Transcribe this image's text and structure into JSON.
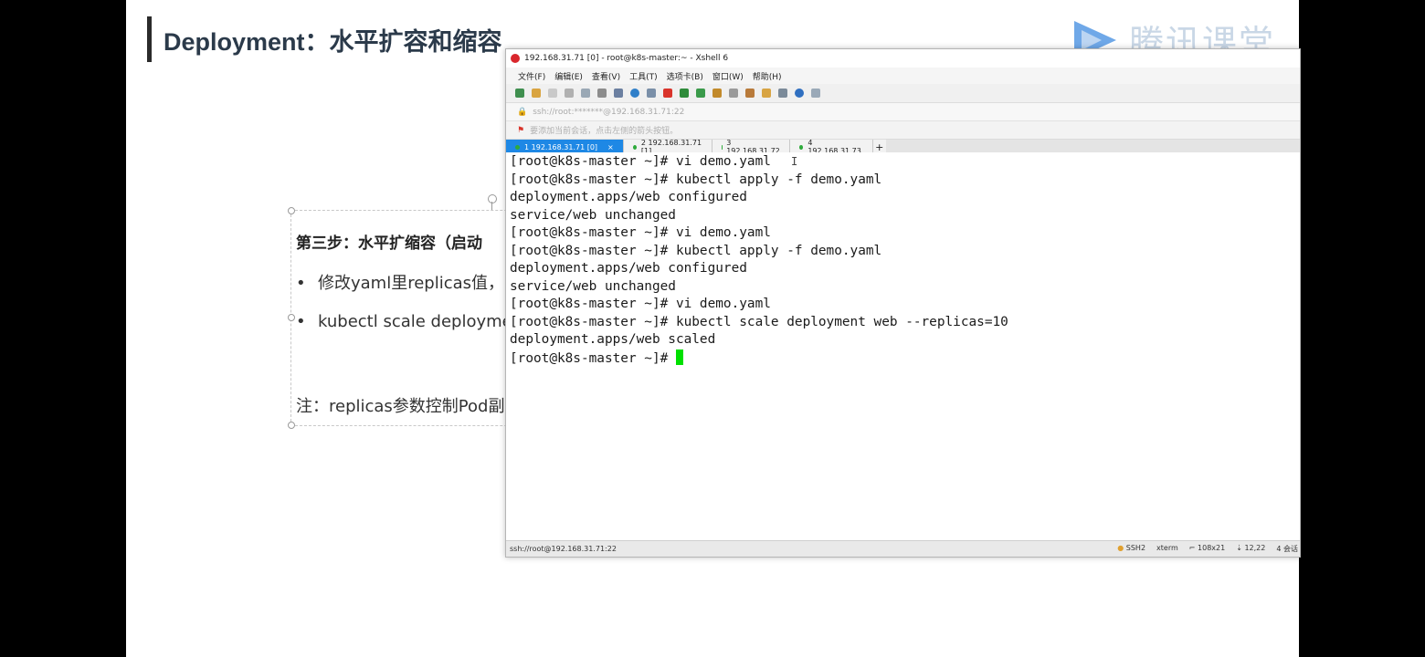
{
  "slide": {
    "title": "Deployment：水平扩容和缩容",
    "logo_text": "腾讯课堂",
    "step_title": "第三步：水平扩缩容（启动",
    "bullets": [
      "修改yaml里replicas值，",
      "kubectl scale deployme"
    ],
    "note": "注：replicas参数控制Pod副"
  },
  "xshell": {
    "window_title": "192.168.31.71 [0] - root@k8s-master:~ - Xshell 6",
    "menu": [
      "文件(F)",
      "编辑(E)",
      "查看(V)",
      "工具(T)",
      "选项卡(B)",
      "窗口(W)",
      "帮助(H)"
    ],
    "address": "ssh://root:*******@192.168.31.71:22",
    "hint": "要添加当前会话，点击左侧的箭头按钮。",
    "tabs": [
      {
        "label": "1 192.168.31.71 [0]",
        "active": true
      },
      {
        "label": "2 192.168.31.71 [1]",
        "active": false
      },
      {
        "label": "3 192.168.31.72",
        "active": false
      },
      {
        "label": "4 192.168.31.73",
        "active": false
      }
    ],
    "tab_add": "+",
    "tab_close": "×",
    "terminal_lines": [
      "[root@k8s-master ~]# vi demo.yaml",
      "[root@k8s-master ~]# kubectl apply -f demo.yaml",
      "deployment.apps/web configured",
      "service/web unchanged",
      "[root@k8s-master ~]# vi demo.yaml",
      "[root@k8s-master ~]# kubectl apply -f demo.yaml",
      "deployment.apps/web configured",
      "service/web unchanged",
      "[root@k8s-master ~]# vi demo.yaml",
      "[root@k8s-master ~]# kubectl scale deployment web --replicas=10",
      "deployment.apps/web scaled",
      "[root@k8s-master ~]# "
    ],
    "status": {
      "connection": "ssh://root@192.168.31.71:22",
      "protocol": "SSH2",
      "term": "xterm",
      "size": "108x21",
      "cursor": "12,22",
      "sessions": "4 会话"
    },
    "colors": {
      "accent": "#1e88e5",
      "cursor": "#00e000"
    }
  }
}
